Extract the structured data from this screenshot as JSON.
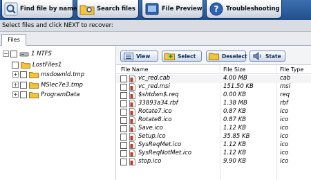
{
  "toolbar": {
    "find_label": "Find file by name",
    "search_label": "Search files",
    "preview_label": "File Preview",
    "troubleshoot_label": "Troubleshooting"
  },
  "instruction": "Select files and click NEXT to recover:",
  "tabs": {
    "files": "Files"
  },
  "tree": {
    "root": "1 NTFS",
    "items": [
      "LostFiles1",
      "msdownld.tmp",
      "MSIec7e3.tmp",
      "ProgramData"
    ]
  },
  "file_toolbar": {
    "view": "View",
    "select": "Select",
    "deselect": "Deselect",
    "state": "State"
  },
  "columns": {
    "name": "File Name",
    "size": "File Size",
    "type": "File Type"
  },
  "files": [
    {
      "name": "vc_red.cab",
      "size": "4.00 MB",
      "type": "cab"
    },
    {
      "name": "vc_red.msi",
      "size": "151.50 KB",
      "type": "msi"
    },
    {
      "name": "$shtdwn$.req",
      "size": "0.00 KB",
      "type": "req"
    },
    {
      "name": "33893a34.rbf",
      "size": "1.38 MB",
      "type": "rbf"
    },
    {
      "name": "Rotate7.ico",
      "size": "0.87 KB",
      "type": "ico"
    },
    {
      "name": "Rotate8.ico",
      "size": "0.87 KB",
      "type": "ico"
    },
    {
      "name": "Save.ico",
      "size": "1.12 KB",
      "type": "ico"
    },
    {
      "name": "Setup.ico",
      "size": "35.85 KB",
      "type": "ico"
    },
    {
      "name": "SysReqMet.ico",
      "size": "1.12 KB",
      "type": "ico"
    },
    {
      "name": "SysReqNotMet.ico",
      "size": "1.12 KB",
      "type": "ico"
    },
    {
      "name": "stop.ico",
      "size": "9.90 KB",
      "type": "ico"
    }
  ],
  "colors": {
    "toolbar_bg": "#1f4e8c",
    "file_icon_red": "#c0392b",
    "folder_yellow": "#f4c23c"
  }
}
